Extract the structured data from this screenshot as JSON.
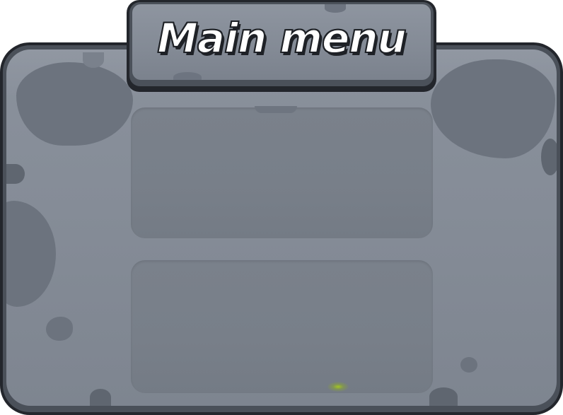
{
  "menu": {
    "title": "Main menu"
  },
  "colors": {
    "frame_outline": "#23262c",
    "stone_face": "#858c97",
    "stone_spot": "#6c737e",
    "slot_fill": "#787f89",
    "title_text": "#ffffff",
    "highlight_glow": "#a5c81e"
  }
}
